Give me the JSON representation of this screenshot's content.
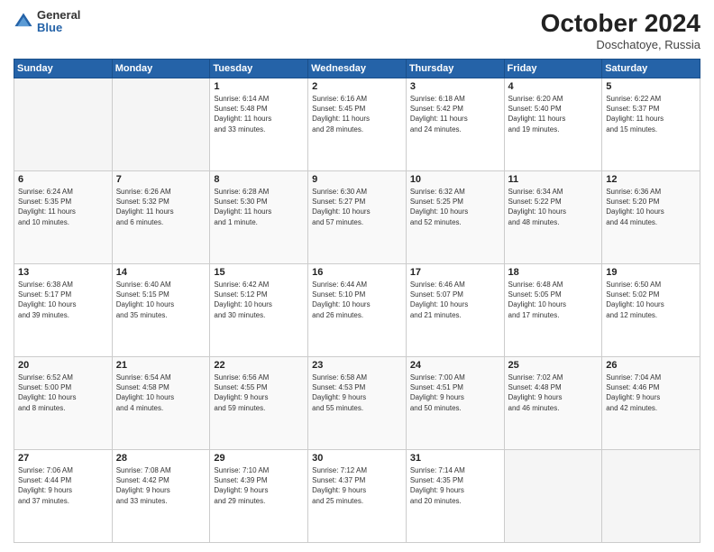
{
  "header": {
    "logo_general": "General",
    "logo_blue": "Blue",
    "month_title": "October 2024",
    "location": "Doschatoye, Russia"
  },
  "weekdays": [
    "Sunday",
    "Monday",
    "Tuesday",
    "Wednesday",
    "Thursday",
    "Friday",
    "Saturday"
  ],
  "weeks": [
    [
      {
        "day": "",
        "info": ""
      },
      {
        "day": "",
        "info": ""
      },
      {
        "day": "1",
        "info": "Sunrise: 6:14 AM\nSunset: 5:48 PM\nDaylight: 11 hours\nand 33 minutes."
      },
      {
        "day": "2",
        "info": "Sunrise: 6:16 AM\nSunset: 5:45 PM\nDaylight: 11 hours\nand 28 minutes."
      },
      {
        "day": "3",
        "info": "Sunrise: 6:18 AM\nSunset: 5:42 PM\nDaylight: 11 hours\nand 24 minutes."
      },
      {
        "day": "4",
        "info": "Sunrise: 6:20 AM\nSunset: 5:40 PM\nDaylight: 11 hours\nand 19 minutes."
      },
      {
        "day": "5",
        "info": "Sunrise: 6:22 AM\nSunset: 5:37 PM\nDaylight: 11 hours\nand 15 minutes."
      }
    ],
    [
      {
        "day": "6",
        "info": "Sunrise: 6:24 AM\nSunset: 5:35 PM\nDaylight: 11 hours\nand 10 minutes."
      },
      {
        "day": "7",
        "info": "Sunrise: 6:26 AM\nSunset: 5:32 PM\nDaylight: 11 hours\nand 6 minutes."
      },
      {
        "day": "8",
        "info": "Sunrise: 6:28 AM\nSunset: 5:30 PM\nDaylight: 11 hours\nand 1 minute."
      },
      {
        "day": "9",
        "info": "Sunrise: 6:30 AM\nSunset: 5:27 PM\nDaylight: 10 hours\nand 57 minutes."
      },
      {
        "day": "10",
        "info": "Sunrise: 6:32 AM\nSunset: 5:25 PM\nDaylight: 10 hours\nand 52 minutes."
      },
      {
        "day": "11",
        "info": "Sunrise: 6:34 AM\nSunset: 5:22 PM\nDaylight: 10 hours\nand 48 minutes."
      },
      {
        "day": "12",
        "info": "Sunrise: 6:36 AM\nSunset: 5:20 PM\nDaylight: 10 hours\nand 44 minutes."
      }
    ],
    [
      {
        "day": "13",
        "info": "Sunrise: 6:38 AM\nSunset: 5:17 PM\nDaylight: 10 hours\nand 39 minutes."
      },
      {
        "day": "14",
        "info": "Sunrise: 6:40 AM\nSunset: 5:15 PM\nDaylight: 10 hours\nand 35 minutes."
      },
      {
        "day": "15",
        "info": "Sunrise: 6:42 AM\nSunset: 5:12 PM\nDaylight: 10 hours\nand 30 minutes."
      },
      {
        "day": "16",
        "info": "Sunrise: 6:44 AM\nSunset: 5:10 PM\nDaylight: 10 hours\nand 26 minutes."
      },
      {
        "day": "17",
        "info": "Sunrise: 6:46 AM\nSunset: 5:07 PM\nDaylight: 10 hours\nand 21 minutes."
      },
      {
        "day": "18",
        "info": "Sunrise: 6:48 AM\nSunset: 5:05 PM\nDaylight: 10 hours\nand 17 minutes."
      },
      {
        "day": "19",
        "info": "Sunrise: 6:50 AM\nSunset: 5:02 PM\nDaylight: 10 hours\nand 12 minutes."
      }
    ],
    [
      {
        "day": "20",
        "info": "Sunrise: 6:52 AM\nSunset: 5:00 PM\nDaylight: 10 hours\nand 8 minutes."
      },
      {
        "day": "21",
        "info": "Sunrise: 6:54 AM\nSunset: 4:58 PM\nDaylight: 10 hours\nand 4 minutes."
      },
      {
        "day": "22",
        "info": "Sunrise: 6:56 AM\nSunset: 4:55 PM\nDaylight: 9 hours\nand 59 minutes."
      },
      {
        "day": "23",
        "info": "Sunrise: 6:58 AM\nSunset: 4:53 PM\nDaylight: 9 hours\nand 55 minutes."
      },
      {
        "day": "24",
        "info": "Sunrise: 7:00 AM\nSunset: 4:51 PM\nDaylight: 9 hours\nand 50 minutes."
      },
      {
        "day": "25",
        "info": "Sunrise: 7:02 AM\nSunset: 4:48 PM\nDaylight: 9 hours\nand 46 minutes."
      },
      {
        "day": "26",
        "info": "Sunrise: 7:04 AM\nSunset: 4:46 PM\nDaylight: 9 hours\nand 42 minutes."
      }
    ],
    [
      {
        "day": "27",
        "info": "Sunrise: 7:06 AM\nSunset: 4:44 PM\nDaylight: 9 hours\nand 37 minutes."
      },
      {
        "day": "28",
        "info": "Sunrise: 7:08 AM\nSunset: 4:42 PM\nDaylight: 9 hours\nand 33 minutes."
      },
      {
        "day": "29",
        "info": "Sunrise: 7:10 AM\nSunset: 4:39 PM\nDaylight: 9 hours\nand 29 minutes."
      },
      {
        "day": "30",
        "info": "Sunrise: 7:12 AM\nSunset: 4:37 PM\nDaylight: 9 hours\nand 25 minutes."
      },
      {
        "day": "31",
        "info": "Sunrise: 7:14 AM\nSunset: 4:35 PM\nDaylight: 9 hours\nand 20 minutes."
      },
      {
        "day": "",
        "info": ""
      },
      {
        "day": "",
        "info": ""
      }
    ]
  ]
}
